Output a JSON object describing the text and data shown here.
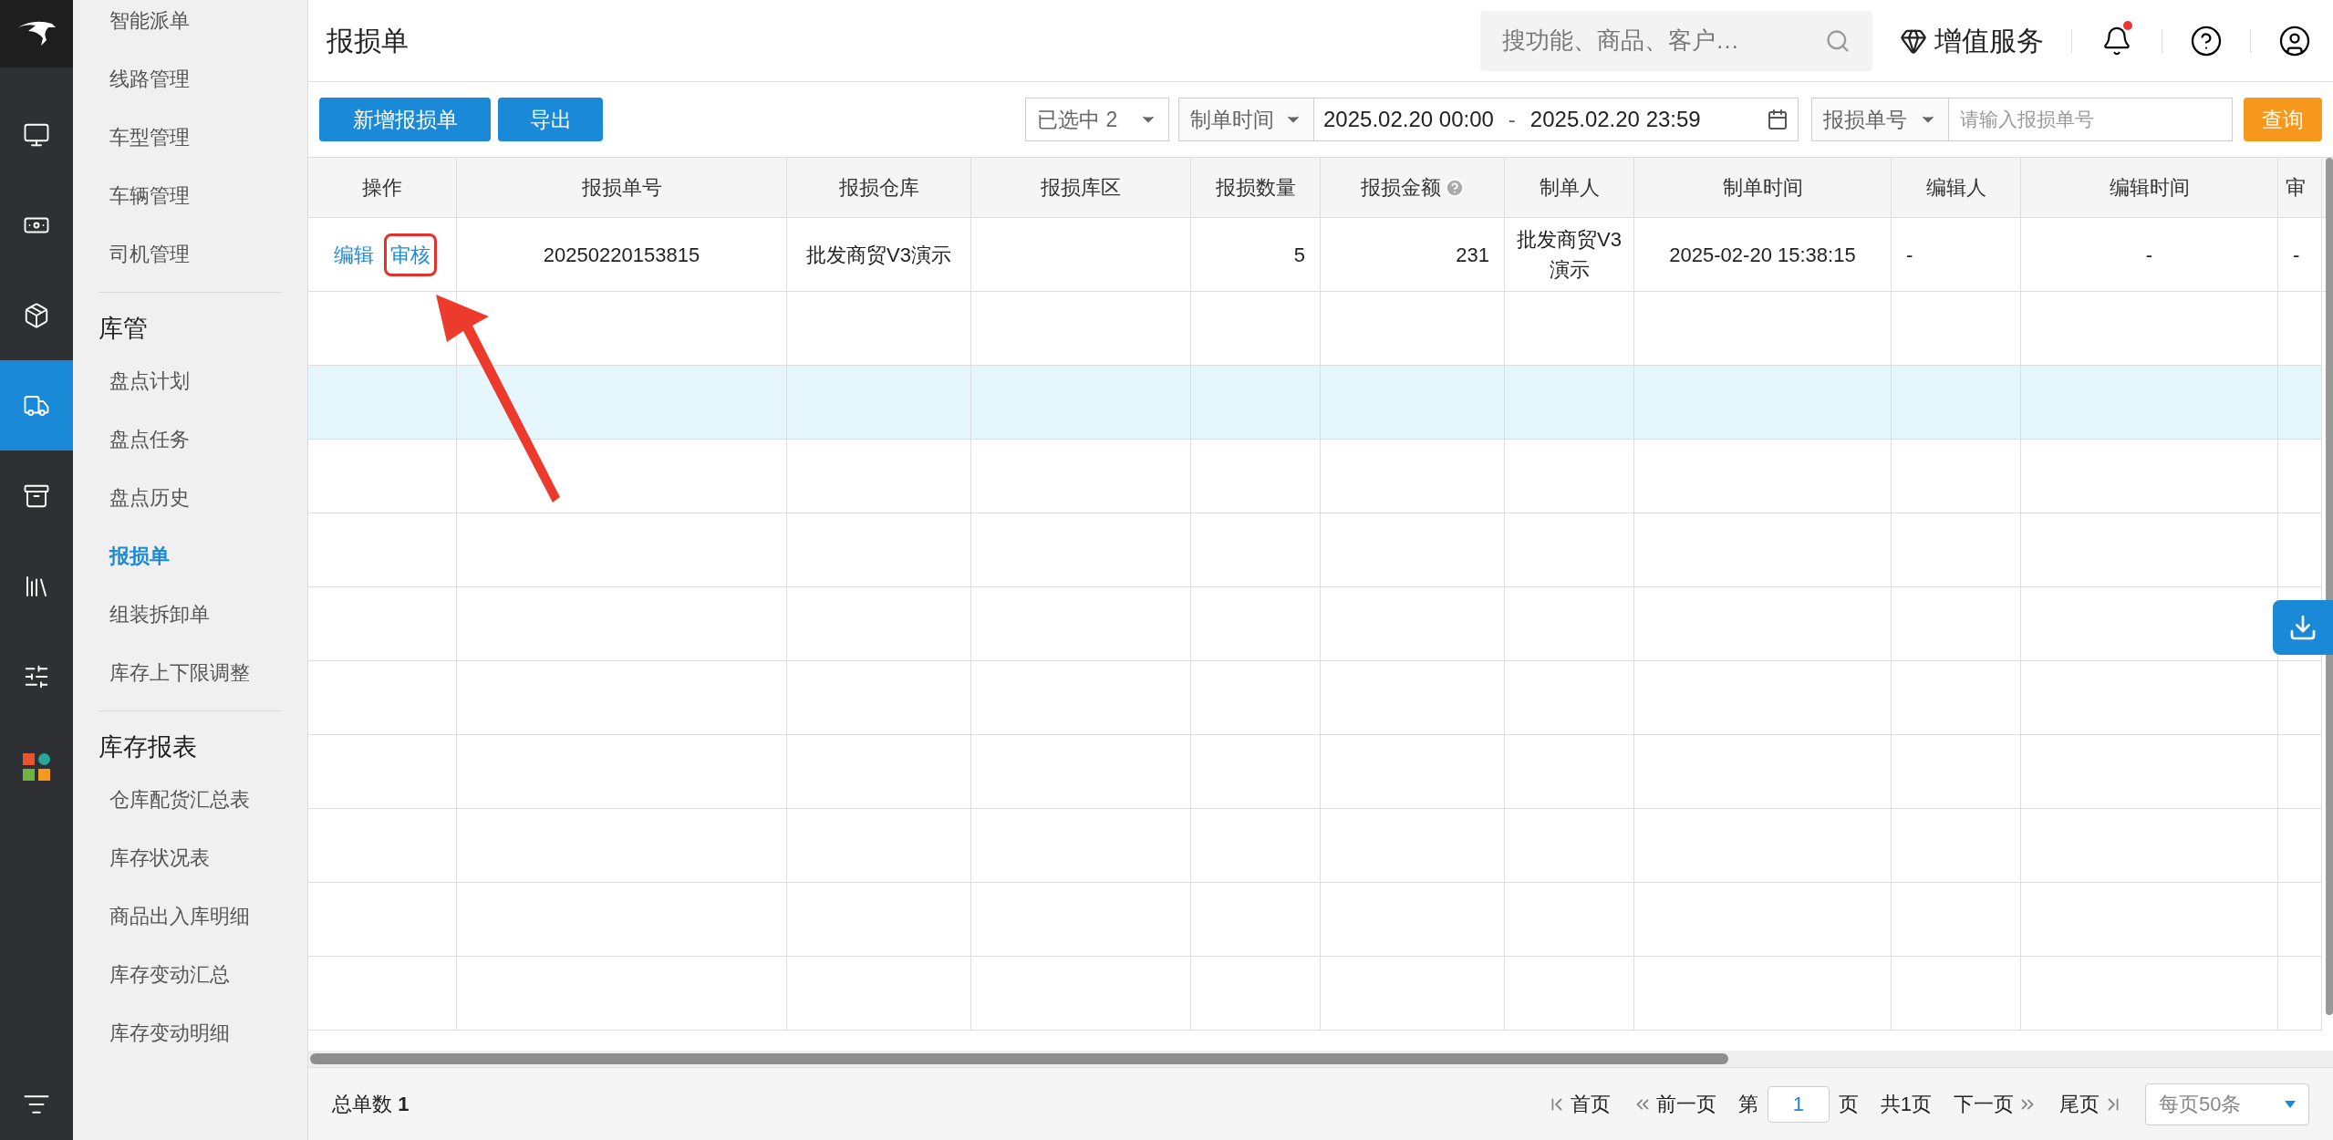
{
  "rail": [
    {
      "kind": "monitor",
      "selected": false
    },
    {
      "kind": "money",
      "selected": false
    },
    {
      "kind": "box",
      "selected": false
    },
    {
      "kind": "truck",
      "selected": true
    },
    {
      "kind": "safe",
      "selected": false
    },
    {
      "kind": "books",
      "selected": false
    },
    {
      "kind": "sliders",
      "selected": false
    },
    {
      "kind": "apps",
      "selected": false
    }
  ],
  "menu": [
    {
      "items": [
        {
          "label": "智能派单",
          "selected": false
        },
        {
          "label": "线路管理",
          "selected": false
        },
        {
          "label": "车型管理",
          "selected": false
        },
        {
          "label": "车辆管理",
          "selected": false
        },
        {
          "label": "司机管理",
          "selected": false
        }
      ]
    },
    {
      "title": "库管",
      "items": [
        {
          "label": "盘点计划",
          "selected": false
        },
        {
          "label": "盘点任务",
          "selected": false
        },
        {
          "label": "盘点历史",
          "selected": false
        },
        {
          "label": "报损单",
          "selected": true
        },
        {
          "label": "组装拆卸单",
          "selected": false
        },
        {
          "label": "库存上下限调整",
          "selected": false
        }
      ]
    },
    {
      "title": "库存报表",
      "items": [
        {
          "label": "仓库配货汇总表",
          "selected": false
        },
        {
          "label": "库存状况表",
          "selected": false
        },
        {
          "label": "商品出入库明细",
          "selected": false
        },
        {
          "label": "库存变动汇总",
          "selected": false
        },
        {
          "label": "库存变动明细",
          "selected": false
        }
      ]
    }
  ],
  "page_title": "报损单",
  "search": {
    "placeholder": "搜功能、商品、客户…"
  },
  "value_service": "增值服务",
  "notification_dot": true,
  "buttons": [
    "新增报损单",
    "导出"
  ],
  "filters": {
    "selected_count": "已选中 2",
    "date_type": "制单时间",
    "date_start": "2025.02.20 00:00",
    "date_sep": "-",
    "date_end": "2025.02.20 23:59",
    "number_type": "报损单号",
    "number_placeholder": "请输入报损单号",
    "query": "查询"
  },
  "table": {
    "action_header": "操作",
    "columns": [
      {
        "label": "报损单号",
        "help": false
      },
      {
        "label": "报损仓库",
        "help": false
      },
      {
        "label": "报损库区",
        "help": false
      },
      {
        "label": "报损数量",
        "help": false
      },
      {
        "label": "报损金额",
        "help": true
      },
      {
        "label": "制单人",
        "help": false
      },
      {
        "label": "制单时间",
        "help": false
      },
      {
        "label": "编辑人",
        "help": false
      },
      {
        "label": "编辑时间",
        "help": false
      },
      {
        "label": "审",
        "help": false
      }
    ],
    "rows": [
      {
        "actions": [
          {
            "label": "编辑",
            "highlighted": false
          },
          {
            "label": "审核",
            "highlighted": true
          }
        ],
        "cells": [
          "20250220153815",
          "批发商贸V3演示",
          "",
          "5",
          "231",
          "批发商贸V3演示",
          "2025-02-20 15:38:15",
          "-",
          "-",
          "-"
        ]
      }
    ],
    "blank_rows": [
      {
        "selected": false
      },
      {
        "selected": true
      },
      {
        "selected": false
      },
      {
        "selected": false
      },
      {
        "selected": false
      },
      {
        "selected": false
      },
      {
        "selected": false
      },
      {
        "selected": false
      },
      {
        "selected": false
      },
      {
        "selected": false
      }
    ]
  },
  "annotation_arrow": true,
  "footer": {
    "total_label": "总单数",
    "total": "1",
    "first": "首页",
    "prev": "前一页",
    "page_prefix": "第",
    "page": "1",
    "page_suffix": "页",
    "page_total": "共1页",
    "next": "下一页",
    "last": "尾页",
    "page_size": "每页50条"
  }
}
